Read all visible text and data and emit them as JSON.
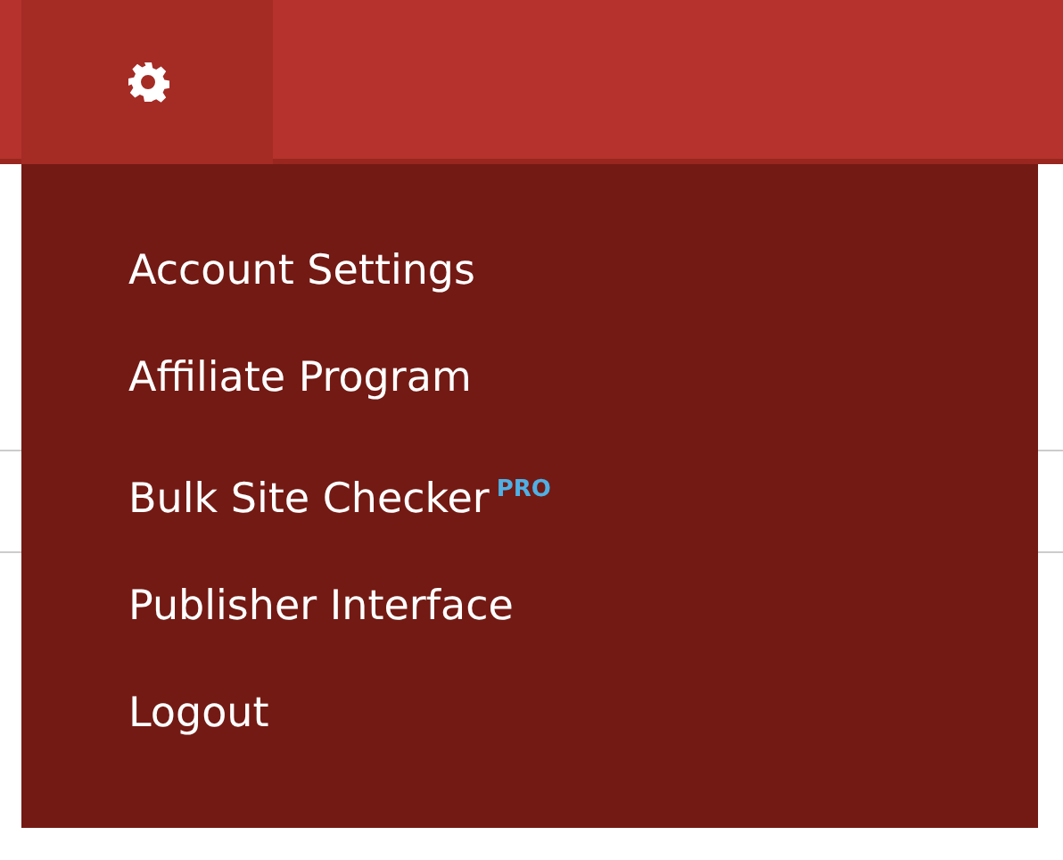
{
  "menu": {
    "expanded": true,
    "items": [
      {
        "label": "Account Settings"
      },
      {
        "label": "Affiliate Program"
      },
      {
        "label": "Bulk Site Checker",
        "badge": "PRO"
      },
      {
        "label": "Publisher Interface"
      },
      {
        "label": "Logout"
      }
    ]
  }
}
